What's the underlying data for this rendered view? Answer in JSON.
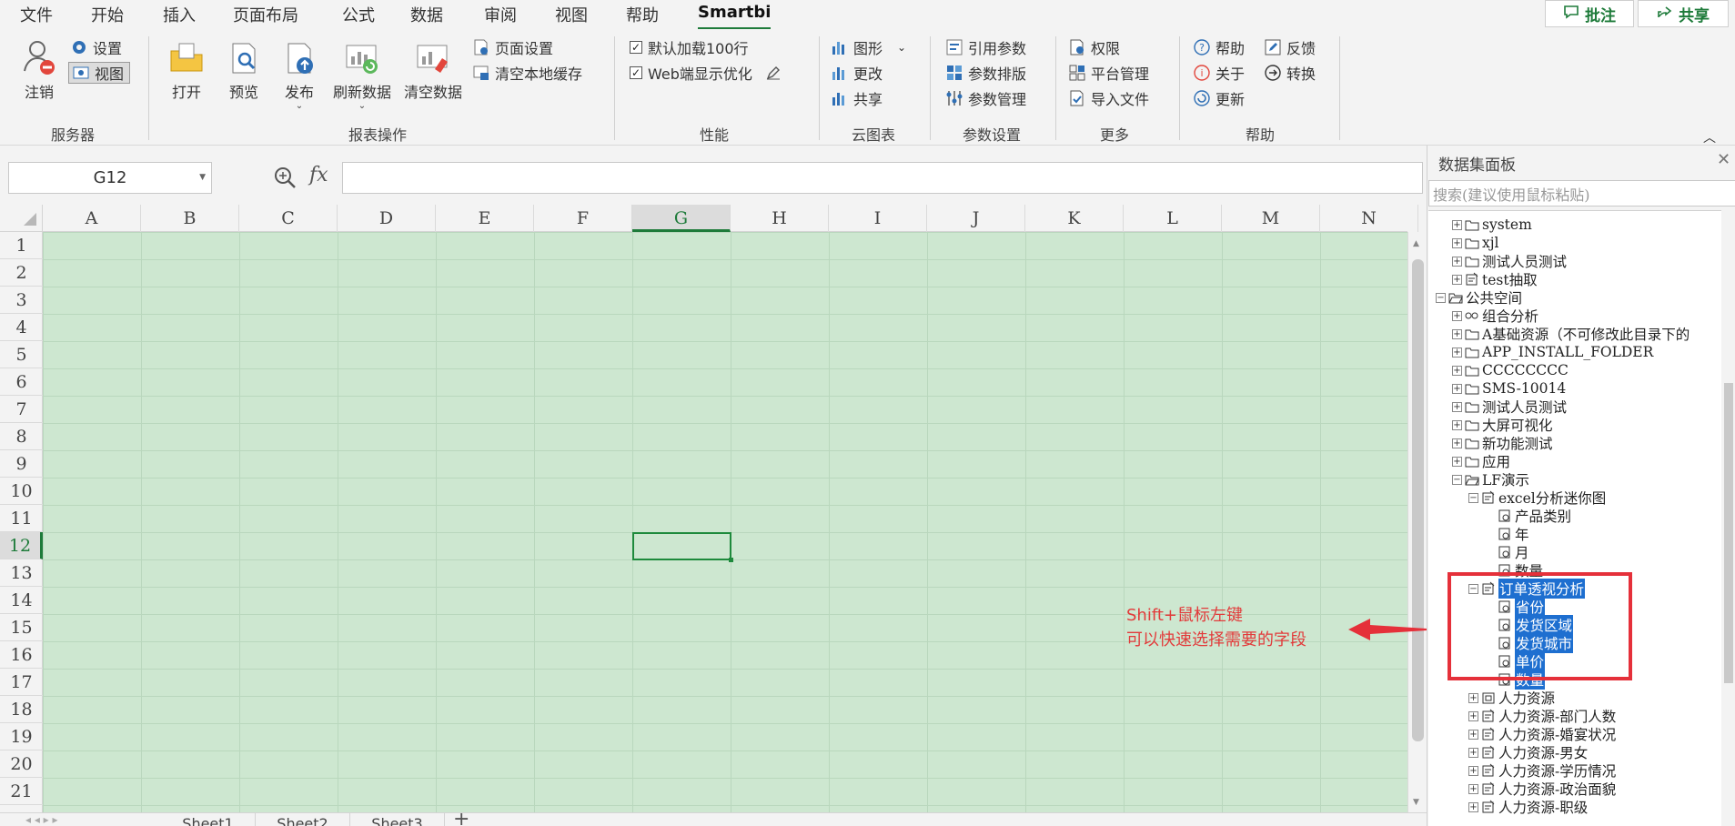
{
  "tabs": [
    "文件",
    "开始",
    "插入",
    "页面布局",
    "公式",
    "数据",
    "审阅",
    "视图",
    "帮助",
    "Smartbi"
  ],
  "active_tab": "Smartbi",
  "top_buttons": {
    "comment": "批注",
    "share": "共享"
  },
  "ribbon": {
    "server": {
      "label": "服务器",
      "logout": "注销",
      "settings": "设置",
      "view": "视图"
    },
    "report_ops": {
      "label": "报表操作",
      "open": "打开",
      "preview": "预览",
      "publish": "发布",
      "refresh": "刷新数据",
      "clear": "清空数据",
      "page_setup": "页面设置",
      "clear_cache": "清空本地缓存"
    },
    "performance": {
      "label": "性能",
      "load100": "默认加载100行",
      "web_opt": "Web端显示优化",
      "load100_checked": true,
      "web_opt_checked": true
    },
    "cloud_chart": {
      "label": "云图表",
      "graph": "图形",
      "edit": "更改",
      "share": "共享"
    },
    "params": {
      "label": "参数设置",
      "ref": "引用参数",
      "sort": "参数排版",
      "manage": "参数管理"
    },
    "more": {
      "label": "更多",
      "perm": "权限",
      "platform": "平台管理",
      "import": "导入文件"
    },
    "help": {
      "label": "帮助",
      "help": "帮助",
      "about": "关于",
      "update": "更新",
      "feedback": "反馈",
      "convert": "转换"
    }
  },
  "formula_bar": {
    "name_box": "G12",
    "fx": "fx",
    "formula": ""
  },
  "sheet": {
    "columns": [
      "A",
      "B",
      "C",
      "D",
      "E",
      "F",
      "G",
      "H",
      "I",
      "J",
      "K",
      "L",
      "M",
      "N"
    ],
    "rows": [
      "1",
      "2",
      "3",
      "4",
      "5",
      "6",
      "7",
      "8",
      "9",
      "10",
      "11",
      "12",
      "13",
      "14",
      "15",
      "16",
      "17",
      "18",
      "19",
      "20",
      "21"
    ],
    "selected_col": "G",
    "selected_row": "12"
  },
  "sheet_tabs": [
    "Sheet1",
    "Sheet2",
    "Sheet3"
  ],
  "active_sheet": "Sheet1",
  "annotation": {
    "line1": "Shift+鼠标左键",
    "line2": "可以快速选择需要的字段"
  },
  "panel": {
    "title": "数据集面板",
    "search_placeholder": "搜索(建议使用鼠标粘贴)",
    "tree": [
      {
        "label": "system",
        "level": 1,
        "exp": "+",
        "icon": "folder"
      },
      {
        "label": "xjl",
        "level": 1,
        "exp": "+",
        "icon": "folder"
      },
      {
        "label": "测试人员测试",
        "level": 1,
        "exp": "+",
        "icon": "folder"
      },
      {
        "label": "test抽取",
        "level": 1,
        "exp": "+",
        "icon": "dataset"
      },
      {
        "label": "公共空间",
        "level": 0,
        "exp": "-",
        "icon": "folder-open"
      },
      {
        "label": "组合分析",
        "level": 1,
        "exp": "+",
        "icon": "combo"
      },
      {
        "label": "A基础资源（不可修改此目录下的",
        "level": 1,
        "exp": "+",
        "icon": "folder"
      },
      {
        "label": "APP_INSTALL_FOLDER",
        "level": 1,
        "exp": "+",
        "icon": "folder"
      },
      {
        "label": "CCCCCCCC",
        "level": 1,
        "exp": "+",
        "icon": "folder"
      },
      {
        "label": "SMS-10014",
        "level": 1,
        "exp": "+",
        "icon": "folder"
      },
      {
        "label": "测试人员测试",
        "level": 1,
        "exp": "+",
        "icon": "folder"
      },
      {
        "label": "大屏可视化",
        "level": 1,
        "exp": "+",
        "icon": "folder"
      },
      {
        "label": "新功能测试",
        "level": 1,
        "exp": "+",
        "icon": "folder"
      },
      {
        "label": "应用",
        "level": 1,
        "exp": "+",
        "icon": "folder"
      },
      {
        "label": "LF演示",
        "level": 1,
        "exp": "-",
        "icon": "folder-open"
      },
      {
        "label": "excel分析迷你图",
        "level": 2,
        "exp": "-",
        "icon": "dataset"
      },
      {
        "label": "产品类别",
        "level": 3,
        "exp": "",
        "icon": "field"
      },
      {
        "label": "年",
        "level": 3,
        "exp": "",
        "icon": "field"
      },
      {
        "label": "月",
        "level": 3,
        "exp": "",
        "icon": "field"
      },
      {
        "label": "数量",
        "level": 3,
        "exp": "",
        "icon": "field"
      },
      {
        "label": "订单透视分析",
        "level": 2,
        "exp": "-",
        "icon": "dataset",
        "hl": true
      },
      {
        "label": "省份",
        "level": 3,
        "exp": "",
        "icon": "field",
        "hl": true
      },
      {
        "label": "发货区域",
        "level": 3,
        "exp": "",
        "icon": "field",
        "hl": true
      },
      {
        "label": "发货城市",
        "level": 3,
        "exp": "",
        "icon": "field",
        "hl": true
      },
      {
        "label": "单价",
        "level": 3,
        "exp": "",
        "icon": "field",
        "hl": true
      },
      {
        "label": "数量",
        "level": 3,
        "exp": "",
        "icon": "field",
        "hl": true
      },
      {
        "label": "人力资源",
        "level": 2,
        "exp": "+",
        "icon": "cube"
      },
      {
        "label": "人力资源-部门人数",
        "level": 2,
        "exp": "+",
        "icon": "dataset"
      },
      {
        "label": "人力资源-婚宴状况",
        "level": 2,
        "exp": "+",
        "icon": "dataset"
      },
      {
        "label": "人力资源-男女",
        "level": 2,
        "exp": "+",
        "icon": "dataset"
      },
      {
        "label": "人力资源-学历情况",
        "level": 2,
        "exp": "+",
        "icon": "dataset"
      },
      {
        "label": "人力资源-政治面貌",
        "level": 2,
        "exp": "+",
        "icon": "dataset"
      },
      {
        "label": "人力资源-职级",
        "level": 2,
        "exp": "+",
        "icon": "dataset"
      }
    ]
  }
}
